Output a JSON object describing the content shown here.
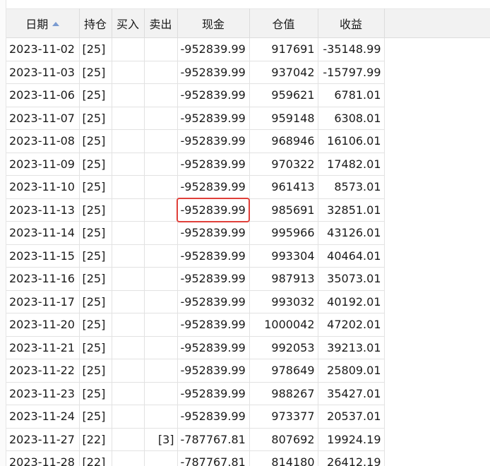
{
  "table": {
    "columns": [
      "日期",
      "持仓",
      "买入",
      "卖出",
      "现金",
      "仓值",
      "收益"
    ],
    "sort_indicator": "sort-ascending-icon",
    "rows": [
      {
        "date": "2023-11-02",
        "hold": "[25]",
        "buy": "",
        "sell": "",
        "cash": "-952839.99",
        "value": "917691",
        "profit": "-35148.99"
      },
      {
        "date": "2023-11-03",
        "hold": "[25]",
        "buy": "",
        "sell": "",
        "cash": "-952839.99",
        "value": "937042",
        "profit": "-15797.99"
      },
      {
        "date": "2023-11-06",
        "hold": "[25]",
        "buy": "",
        "sell": "",
        "cash": "-952839.99",
        "value": "959621",
        "profit": "6781.01"
      },
      {
        "date": "2023-11-07",
        "hold": "[25]",
        "buy": "",
        "sell": "",
        "cash": "-952839.99",
        "value": "959148",
        "profit": "6308.01"
      },
      {
        "date": "2023-11-08",
        "hold": "[25]",
        "buy": "",
        "sell": "",
        "cash": "-952839.99",
        "value": "968946",
        "profit": "16106.01"
      },
      {
        "date": "2023-11-09",
        "hold": "[25]",
        "buy": "",
        "sell": "",
        "cash": "-952839.99",
        "value": "970322",
        "profit": "17482.01"
      },
      {
        "date": "2023-11-10",
        "hold": "[25]",
        "buy": "",
        "sell": "",
        "cash": "-952839.99",
        "value": "961413",
        "profit": "8573.01"
      },
      {
        "date": "2023-11-13",
        "hold": "[25]",
        "buy": "",
        "sell": "",
        "cash": "-952839.99",
        "value": "985691",
        "profit": "32851.01"
      },
      {
        "date": "2023-11-14",
        "hold": "[25]",
        "buy": "",
        "sell": "",
        "cash": "-952839.99",
        "value": "995966",
        "profit": "43126.01"
      },
      {
        "date": "2023-11-15",
        "hold": "[25]",
        "buy": "",
        "sell": "",
        "cash": "-952839.99",
        "value": "993304",
        "profit": "40464.01"
      },
      {
        "date": "2023-11-16",
        "hold": "[25]",
        "buy": "",
        "sell": "",
        "cash": "-952839.99",
        "value": "987913",
        "profit": "35073.01"
      },
      {
        "date": "2023-11-17",
        "hold": "[25]",
        "buy": "",
        "sell": "",
        "cash": "-952839.99",
        "value": "993032",
        "profit": "40192.01"
      },
      {
        "date": "2023-11-20",
        "hold": "[25]",
        "buy": "",
        "sell": "",
        "cash": "-952839.99",
        "value": "1000042",
        "profit": "47202.01"
      },
      {
        "date": "2023-11-21",
        "hold": "[25]",
        "buy": "",
        "sell": "",
        "cash": "-952839.99",
        "value": "992053",
        "profit": "39213.01"
      },
      {
        "date": "2023-11-22",
        "hold": "[25]",
        "buy": "",
        "sell": "",
        "cash": "-952839.99",
        "value": "978649",
        "profit": "25809.01"
      },
      {
        "date": "2023-11-23",
        "hold": "[25]",
        "buy": "",
        "sell": "",
        "cash": "-952839.99",
        "value": "988267",
        "profit": "35427.01"
      },
      {
        "date": "2023-11-24",
        "hold": "[25]",
        "buy": "",
        "sell": "",
        "cash": "-952839.99",
        "value": "973377",
        "profit": "20537.01"
      },
      {
        "date": "2023-11-27",
        "hold": "[22]",
        "buy": "",
        "sell": "[3]",
        "cash": "-787767.81",
        "value": "807692",
        "profit": "19924.19"
      },
      {
        "date": "2023-11-28",
        "hold": "[22]",
        "buy": "",
        "sell": "",
        "cash": "-787767.81",
        "value": "814180",
        "profit": "26412.19"
      }
    ],
    "highlighted_row": 7,
    "highlight_color": "#e0403a",
    "sort_arrow_color": "#7a9bd1",
    "header_bg": "#f2f2f2"
  }
}
